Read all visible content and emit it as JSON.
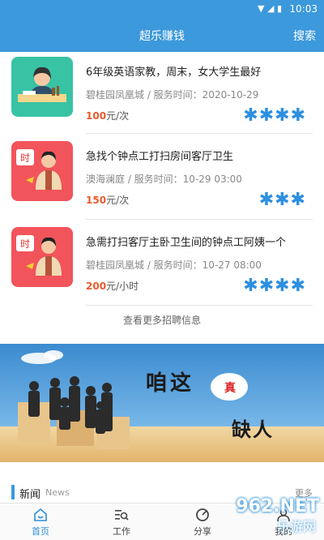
{
  "status_bar": {
    "time": "10:03",
    "icons": "▼ ◢ ▮"
  },
  "app_bar": {
    "title": "超乐赚钱",
    "search_label": "搜索"
  },
  "jobs": [
    {
      "title": "6年级英语家教，周末，女大学生最好",
      "meta": "碧桂园凤凰城 / 服务时间：2020-10-29",
      "price": "100",
      "unit": "元/次",
      "rating": 4,
      "stars": "✱✱✱✱",
      "thumb": "green"
    },
    {
      "title": "急找个钟点工打扫房间客厅卫生",
      "meta": "澳海澜庭 / 服务时间：10-29 03:00",
      "price": "150",
      "unit": "元/次",
      "rating": 3,
      "stars": "✱✱✱",
      "thumb": "red",
      "thumb_label": "时"
    },
    {
      "title": "急需打扫客厅主卧卫生间的钟点工阿姨一个",
      "meta": "碧桂园凤凰城 / 服务时间：10-27 08:00",
      "price": "200",
      "unit": "元/小时",
      "rating": 4,
      "stars": "✱✱✱✱",
      "thumb": "red",
      "thumb_label": "时"
    }
  ],
  "more_jobs_label": "查看更多招聘信息",
  "banner": {
    "text1": "咱这",
    "bubble": "真",
    "text2": "缺人"
  },
  "news": {
    "title": "新闻",
    "subtitle": "News",
    "more": "更多"
  },
  "nav": [
    {
      "label": "首页",
      "icon": "home-icon"
    },
    {
      "label": "工作",
      "icon": "search-list-icon"
    },
    {
      "label": "分享",
      "icon": "share-icon"
    },
    {
      "label": "我的",
      "icon": "user-icon"
    }
  ],
  "watermark": {
    "main": "962.NET",
    "sub": "乐游网"
  },
  "colors": {
    "primary": "#3c99dc",
    "price": "#e75a2b",
    "stars": "#2d8fe0"
  }
}
